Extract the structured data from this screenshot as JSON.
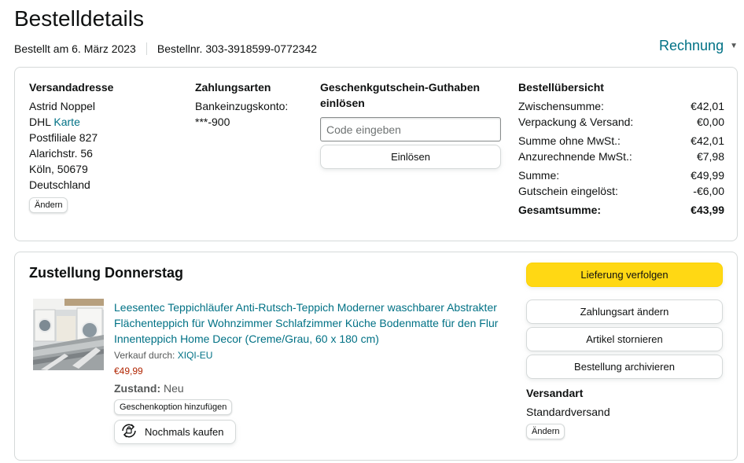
{
  "page": {
    "title": "Bestelldetails",
    "ordered_on": "Bestellt am 6. März 2023",
    "order_number": "Bestellnr. 303-3918599-0772342",
    "invoice_link": "Rechnung"
  },
  "address": {
    "heading": "Versandadresse",
    "name": "Astrid Noppel",
    "carrier": "DHL",
    "map_link": "Karte",
    "line1": "Postfiliale 827",
    "line2": "Alarichstr. 56",
    "line3": "Köln, 50679",
    "line4": "Deutschland",
    "change_label": "Ändern"
  },
  "payment": {
    "heading": "Zahlungsarten",
    "method": "Bankeinzugskonto:",
    "account": "***-900"
  },
  "gift_card": {
    "heading": "Geschenkgutschein-Guthaben einlösen",
    "placeholder": "Code eingeben",
    "redeem_label": "Einlösen"
  },
  "summary": {
    "heading": "Bestellübersicht",
    "rows": [
      {
        "label": "Zwischensumme:",
        "value": "€42,01"
      },
      {
        "label": "Verpackung & Versand:",
        "value": "€0,00"
      },
      {
        "label": "Summe ohne MwSt.:",
        "value": "€42,01"
      },
      {
        "label": "Anzurechnende MwSt.:",
        "value": "€7,98"
      },
      {
        "label": "Summe:",
        "value": "€49,99"
      },
      {
        "label": "Gutschein eingelöst:",
        "value": "-€6,00"
      },
      {
        "label": "Gesamtsumme:",
        "value": "€43,99"
      }
    ]
  },
  "delivery": {
    "title": "Zustellung Donnerstag",
    "product_title": "Leesentec Teppichläufer Anti-Rutsch-Teppich Moderner waschbarer Abstrakter Flächenteppich für Wohnzimmer Schlafzimmer Küche Bodenmatte für den Flur Innenteppich Home Decor (Creme/Grau, 60 x 180 cm)",
    "seller_prefix": "Verkauf durch:",
    "seller_name": "XIQI-EU",
    "price": "€49,99",
    "condition_label": "Zustand:",
    "condition_value": "Neu",
    "gift_option_label": "Geschenkoption hinzufügen",
    "buy_again_label": "Nochmals kaufen"
  },
  "actions": {
    "track": "Lieferung verfolgen",
    "change_payment": "Zahlungsart ändern",
    "cancel_items": "Artikel stornieren",
    "archive_order": "Bestellung archivieren",
    "shipping_label": "Versandart",
    "shipping_value": "Standardversand",
    "change_label": "Ändern"
  },
  "colors": {
    "link": "#007185",
    "price": "#b12704",
    "primary_button": "#ffd814",
    "border": "#d5d9d9"
  },
  "icons": {
    "invoice_chevron": "chevron-down-icon",
    "buy_again": "buy-again-icon"
  }
}
